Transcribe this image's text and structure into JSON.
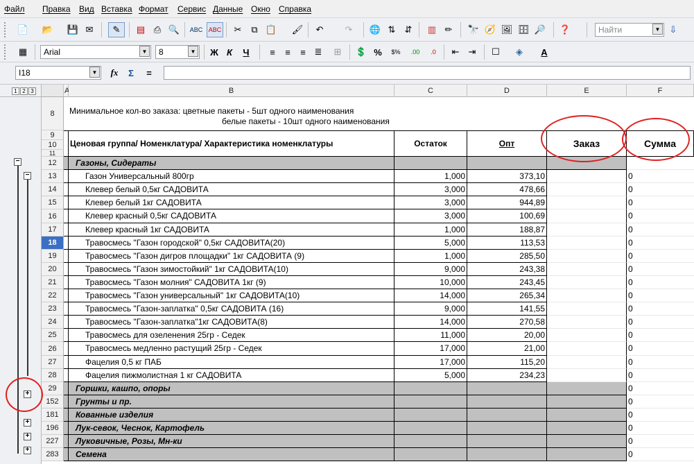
{
  "menu": [
    "Файл",
    "Правка",
    "Вид",
    "Вставка",
    "Формат",
    "Сервис",
    "Данные",
    "Окно",
    "Справка"
  ],
  "toolbar": {
    "search_placeholder": "Найти",
    "font_name": "Arial",
    "font_size": "8",
    "bold": "Ж",
    "italic": "К",
    "underline": "Ч"
  },
  "formula": {
    "cell_ref": "I18",
    "content": ""
  },
  "outline_levels": [
    "1",
    "2",
    "3"
  ],
  "columns": [
    "A",
    "B",
    "C",
    "D",
    "E",
    "F"
  ],
  "header": {
    "row8": "8",
    "row9": "9",
    "row10": "10",
    "row11": "11",
    "min_order_line1": "Минимальное кол-во заказа: цветные пакеты - 5шт одного наименования",
    "min_order_line2": "белые пакеты    - 10шт одного наименования",
    "col_b": "Ценовая группа/ Номенклатура/ Характеристика номенклатуры",
    "col_c": "Остаток",
    "col_d": "Опт",
    "col_e": "Заказ",
    "col_f": "Сумма"
  },
  "rows": [
    {
      "num": "12",
      "name": "Газоны, Сидераты",
      "qty": "",
      "price": "",
      "sum": "",
      "group": true
    },
    {
      "num": "13",
      "name": "Газон Универсальный 800гр",
      "qty": "1,000",
      "price": "373,10",
      "sum": "0"
    },
    {
      "num": "14",
      "name": "Клевер белый 0,5кг САДОВИТА",
      "qty": "3,000",
      "price": "478,66",
      "sum": "0"
    },
    {
      "num": "15",
      "name": "Клевер белый 1кг САДОВИТА",
      "qty": "3,000",
      "price": "944,89",
      "sum": "0"
    },
    {
      "num": "16",
      "name": "Клевер красный 0,5кг САДОВИТА",
      "qty": "3,000",
      "price": "100,69",
      "sum": "0"
    },
    {
      "num": "17",
      "name": "Клевер красный 1кг САДОВИТА",
      "qty": "1,000",
      "price": "188,87",
      "sum": "0"
    },
    {
      "num": "18",
      "name": "Травосмесь \"Газон городской\" 0,5кг САДОВИТА(20)",
      "qty": "5,000",
      "price": "113,53",
      "sum": "0",
      "selected": true
    },
    {
      "num": "19",
      "name": "Травосмесь \"Газон дигров площадки\" 1кг САДОВИТА (9)",
      "qty": "1,000",
      "price": "285,50",
      "sum": "0"
    },
    {
      "num": "20",
      "name": "Травосмесь \"Газон зимостойкий\" 1кг САДОВИТА(10)",
      "qty": "9,000",
      "price": "243,38",
      "sum": "0"
    },
    {
      "num": "21",
      "name": "Травосмесь \"Газон молния\" САДОВИТА 1кг (9)",
      "qty": "10,000",
      "price": "243,45",
      "sum": "0"
    },
    {
      "num": "22",
      "name": "Травосмесь \"Газон универсальный\" 1кг САДОВИТА(10)",
      "qty": "14,000",
      "price": "265,34",
      "sum": "0"
    },
    {
      "num": "23",
      "name": "Травосмесь \"Газон-заплатка\" 0,5кг САДОВИТА (16)",
      "qty": "9,000",
      "price": "141,55",
      "sum": "0"
    },
    {
      "num": "24",
      "name": "Травосмесь \"Газон-заплатка\"1кг САДОВИТА(8)",
      "qty": "14,000",
      "price": "270,58",
      "sum": "0"
    },
    {
      "num": "25",
      "name": "Травосмесь для озеленения 25гр - Седек",
      "qty": "11,000",
      "price": "20,00",
      "sum": "0"
    },
    {
      "num": "26",
      "name": "Травосмесь медленно растущий 25гр - Седек",
      "qty": "17,000",
      "price": "21,00",
      "sum": "0"
    },
    {
      "num": "27",
      "name": "Фацелия 0,5 кг ПАБ",
      "qty": "17,000",
      "price": "115,20",
      "sum": "0"
    },
    {
      "num": "28",
      "name": "Фацелия пижмолистная 1 кг САДОВИТА",
      "qty": "5,000",
      "price": "234,23",
      "sum": "0"
    },
    {
      "num": "29",
      "name": "Горшки, кашпо, опоры",
      "qty": "",
      "price": "",
      "sum": "0",
      "group": true
    },
    {
      "num": "152",
      "name": "Грунты и пр.",
      "qty": "",
      "price": "",
      "sum": "0",
      "group": true
    },
    {
      "num": "181",
      "name": "Кованные изделия",
      "qty": "",
      "price": "",
      "sum": "0",
      "group": true
    },
    {
      "num": "196",
      "name": "Лук-севок, Чеснок, Картофель",
      "qty": "",
      "price": "",
      "sum": "0",
      "group": true
    },
    {
      "num": "227",
      "name": "Луковичные, Розы, Мн-ки",
      "qty": "",
      "price": "",
      "sum": "0",
      "group": true
    },
    {
      "num": "283",
      "name": "Семена",
      "qty": "",
      "price": "",
      "sum": "0",
      "group": true
    }
  ],
  "colors": {
    "group_fill": "#c0c0c0",
    "annotation": "#e02020",
    "selected_row": "#3a6fc4"
  }
}
